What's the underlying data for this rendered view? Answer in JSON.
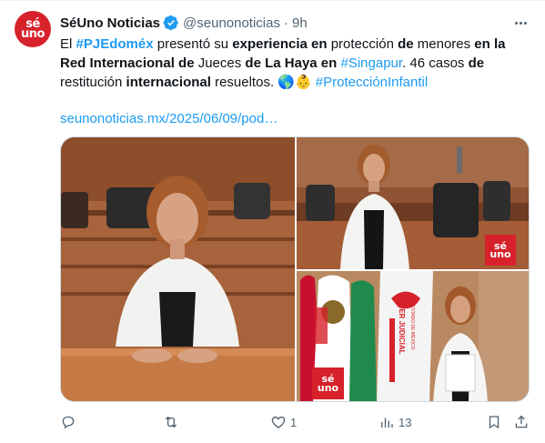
{
  "author": {
    "name": "SéUno Noticias",
    "handle": "@seunonoticias",
    "separator": "·",
    "time": "9h",
    "avatar_line1": "sé",
    "avatar_line2": "uno",
    "verified_color": "#1d9bf0",
    "avatar_color": "#d7212b"
  },
  "tweet": {
    "t1": "El ",
    "t2": "#PJEdoméx",
    "t3": " presentó su ",
    "t4": "experiencia",
    "t5": " ",
    "t6": "en",
    "t7": " protección ",
    "t8": "de",
    "t9": " menores ",
    "t10": "en la Red Internacional de",
    "t11": " Jueces ",
    "t12": "de La Haya en",
    "t13": " ",
    "t14": "#Singapur",
    "t15": ". 46 casos ",
    "t16": "de",
    "t17": " restitución ",
    "t18": "internacional",
    "t19": " resueltos. 🌎👶 ",
    "t20": "#ProtecciónInfantil",
    "url": "seunonoticias.mx/2025/06/09/pod…"
  },
  "media": {
    "logo_line1": "sé",
    "logo_line2": "uno",
    "banner_line1": "PODER JUDICIAL",
    "banner_line2": "DEL ESTADO DE MÉXICO"
  },
  "actions": {
    "reply_count": "",
    "retweet_count": "",
    "like_count": "1",
    "views_count": "13"
  },
  "colors": {
    "link": "#1d9bf0",
    "secondary_text": "#536471",
    "brand_red": "#d7212b"
  }
}
